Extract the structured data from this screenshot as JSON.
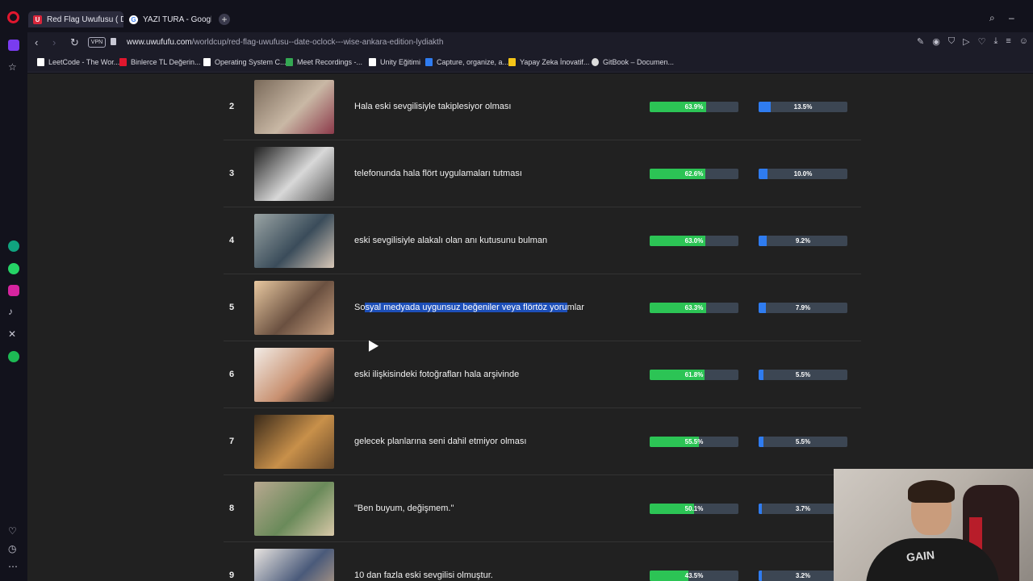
{
  "browser": {
    "tabs": [
      {
        "label": "Red Flag Uwufusu ( D",
        "favicon": "U",
        "active": true
      },
      {
        "label": "YAZI TURA - Google Search",
        "favicon": "G",
        "active": false
      }
    ],
    "vpn_label": "VPN",
    "url_domain": "www.uwufufu.com",
    "url_path": "/worldcup/red-flag-uwufusu--date-oclock---wise-ankara-edition-lydiakth",
    "bookmarks": [
      {
        "label": "LeetCode - The Wor...",
        "color": "#ffffff"
      },
      {
        "label": "Binlerce TL Değerin...",
        "color": "#e0172e"
      },
      {
        "label": "Operating System C...",
        "color": "#ffffff"
      },
      {
        "label": "Meet Recordings -...",
        "color": "#34a853"
      },
      {
        "label": "Unity Eğitimi",
        "color": "#ffffff"
      },
      {
        "label": "Capture, organize, a...",
        "color": "#2f7cf0"
      },
      {
        "label": "Yapay Zeka İnovatif...",
        "color": "#f5c518"
      },
      {
        "label": "GitBook – Documen...",
        "color": "#dddddd"
      }
    ]
  },
  "results": [
    {
      "rank": "2",
      "title": "Hala eski sevgilisiyle takiplesiyor olması",
      "win_rate": 63.9,
      "win_label": "63.9%",
      "pick_rate": 13.5,
      "pick_label": "13.5%",
      "thumb": [
        "#7a6a5a",
        "#c9b8a5",
        "#8c3a4a"
      ]
    },
    {
      "rank": "3",
      "title": "telefonunda hala flört uygulamaları tutması",
      "win_rate": 62.6,
      "win_label": "62.6%",
      "pick_rate": 10.0,
      "pick_label": "10.0%",
      "thumb": [
        "#202020",
        "#d8d8d8",
        "#5a5a5a"
      ]
    },
    {
      "rank": "4",
      "title": "eski sevgilisiyle alakalı olan anı kutusunu bulman",
      "win_rate": 63.0,
      "win_label": "63.0%",
      "pick_rate": 9.2,
      "pick_label": "9.2%",
      "thumb": [
        "#9aa4a4",
        "#3a4c5a",
        "#d8c8b8"
      ]
    },
    {
      "rank": "5",
      "title_pre": "So",
      "title_hl": "syal medyada uygunsuz beğeniler veya flörtöz yoru",
      "title_post": "mlar",
      "win_rate": 63.3,
      "win_label": "63.3%",
      "pick_rate": 7.9,
      "pick_label": "7.9%",
      "thumb": [
        "#e8c8a0",
        "#6a5040",
        "#c8a080"
      ]
    },
    {
      "rank": "6",
      "title": "eski ilişkisindeki fotoğrafları hala arşivinde",
      "win_rate": 61.8,
      "win_label": "61.8%",
      "pick_rate": 5.5,
      "pick_label": "5.5%",
      "thumb": [
        "#f2ece6",
        "#c89070",
        "#1a1a1a"
      ]
    },
    {
      "rank": "7",
      "title": "gelecek planlarına seni dahil etmiyor olması",
      "win_rate": 55.5,
      "win_label": "55.5%",
      "pick_rate": 5.5,
      "pick_label": "5.5%",
      "thumb": [
        "#3a2a1a",
        "#c8904a",
        "#6a4a2a"
      ]
    },
    {
      "rank": "8",
      "title": "\"Ben buyum, değişmem.\"",
      "win_rate": 50.1,
      "win_label": "50.1%",
      "pick_rate": 3.7,
      "pick_label": "3.7%",
      "thumb": [
        "#b8a890",
        "#6a8a5a",
        "#d8c8a8"
      ]
    },
    {
      "rank": "9",
      "title": "10 dan fazla eski sevgilisi olmuştur.",
      "win_rate": 43.5,
      "win_label": "43.5%",
      "pick_rate": 3.2,
      "pick_label": "3.2%",
      "thumb": [
        "#e8e4e0",
        "#4a5a7a",
        "#c8a888"
      ]
    }
  ],
  "webcam": {
    "shirt_text": "GAIN"
  }
}
